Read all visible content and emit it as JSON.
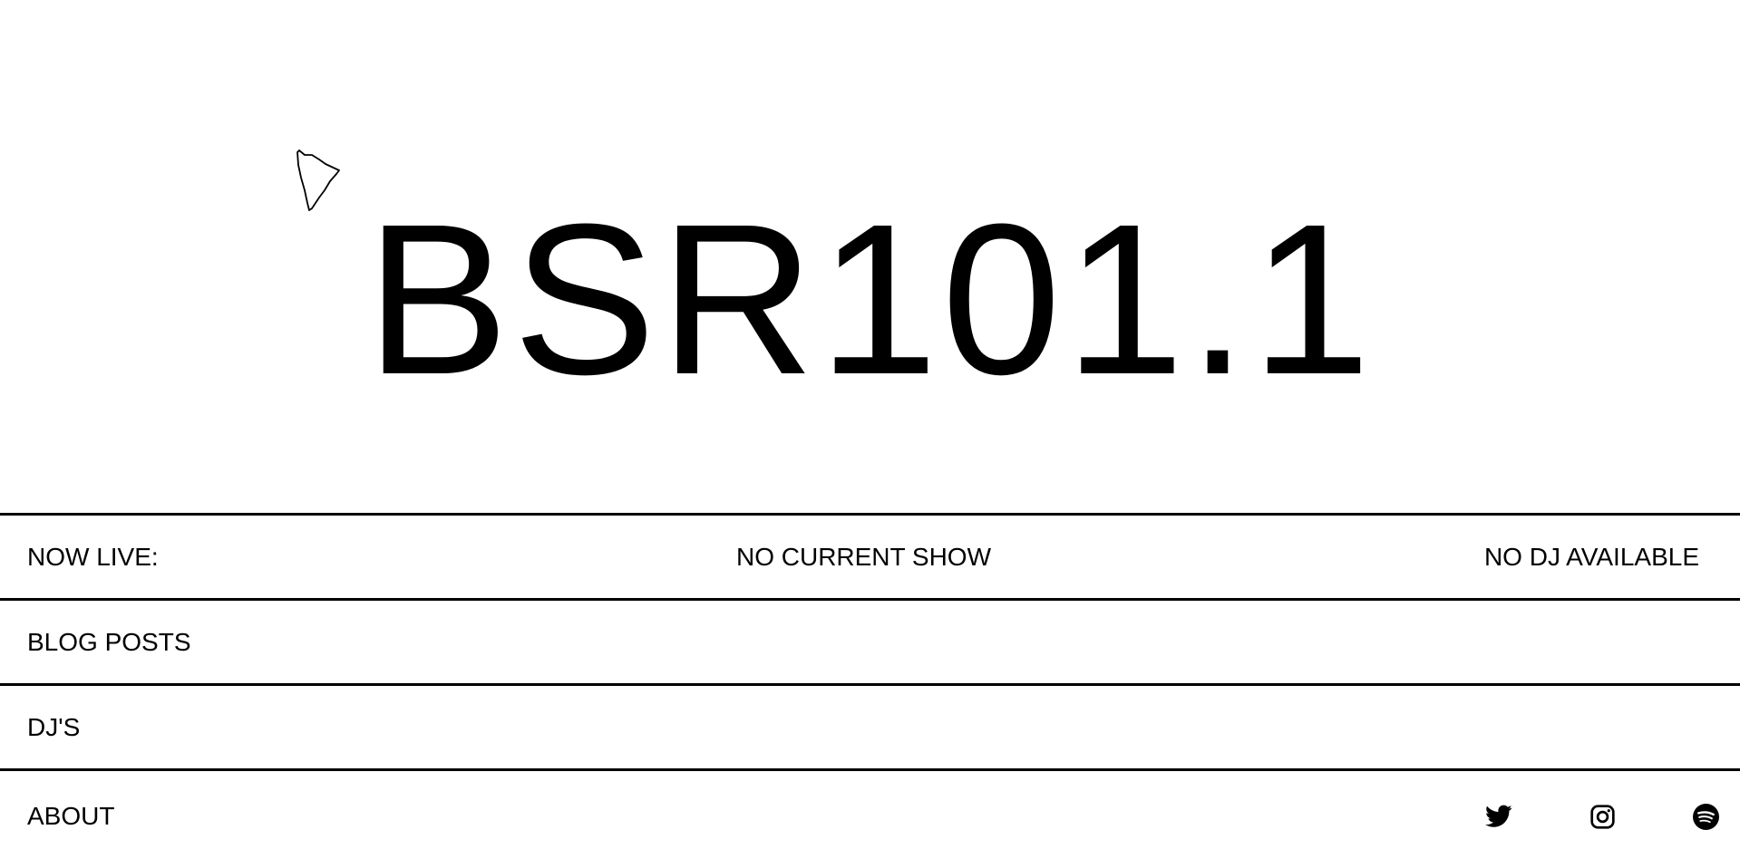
{
  "site": {
    "logo_text": "BSR101.1"
  },
  "now_live": {
    "label": "NOW LIVE:",
    "show": "NO CURRENT SHOW",
    "dj": "NO DJ AVAILABLE"
  },
  "nav": {
    "blog_label": "BLOG POSTS",
    "djs_label": "DJ'S",
    "about_label": "ABOUT"
  },
  "social": {
    "icons": [
      "twitter-icon",
      "instagram-icon",
      "spotify-icon"
    ]
  }
}
